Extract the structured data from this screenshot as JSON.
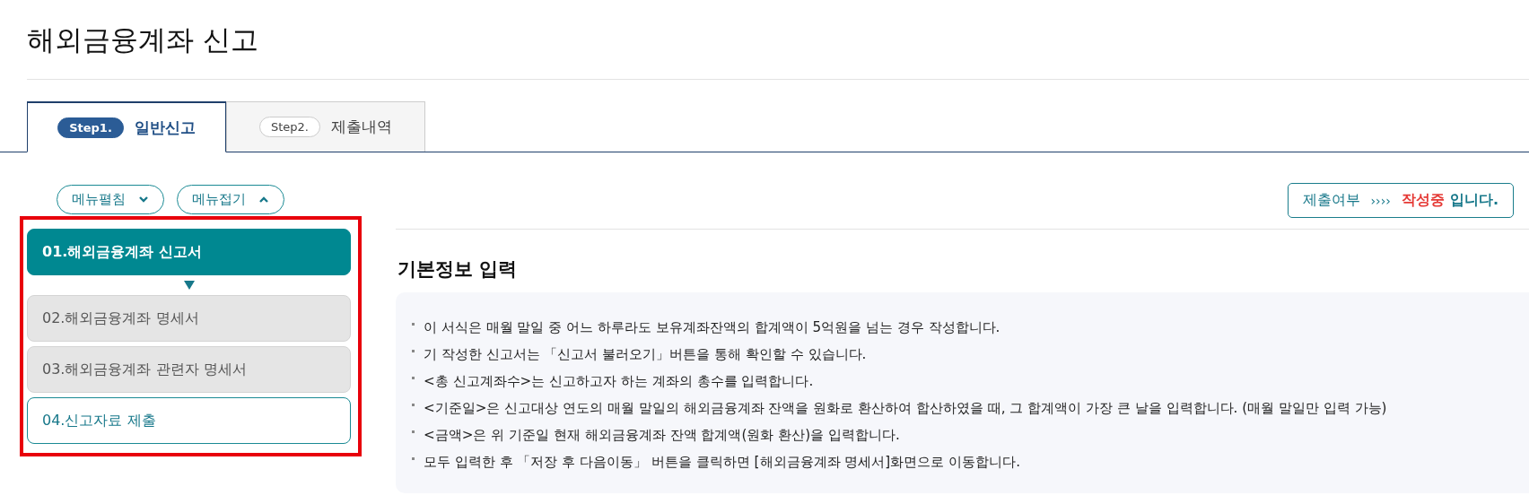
{
  "page_title": "해외금융계좌 신고",
  "tabs": [
    {
      "step": "Step1.",
      "label": "일반신고",
      "selected": true
    },
    {
      "step": "Step2.",
      "label": "제출내역",
      "selected": false
    }
  ],
  "menu_controls": [
    {
      "label": "메뉴펼침",
      "kind": "expand"
    },
    {
      "label": "메뉴접기",
      "kind": "collapse"
    }
  ],
  "menu_items": [
    {
      "label": "01.해외금융계좌 신고서",
      "selected": true,
      "disabled": false
    },
    {
      "label": "02.해외금융계좌 명세서",
      "selected": false,
      "disabled": true
    },
    {
      "label": "03.해외금융계좌 관련자 명세서",
      "selected": false,
      "disabled": true
    },
    {
      "label": "04.신고자료 제출",
      "selected": false,
      "disabled": false
    }
  ],
  "status": {
    "label": "제출여부",
    "arrows": "››››",
    "value": "작성중",
    "suffix": "입니다."
  },
  "section_title": "기본정보 입력",
  "notes": [
    "이 서식은 매월 말일 중 어느 하루라도 보유계좌잔액의 합계액이 5억원을 넘는 경우 작성합니다.",
    "기 작성한 신고서는 「신고서 불러오기」버튼을 통해 확인할 수 있습니다.",
    "<총 신고계좌수>는 신고하고자 하는 계좌의 총수를 입력합니다.",
    "<기준일>은 신고대상 연도의 매월 말일의 해외금융계좌 잔액을 원화로 환산하여 합산하였을 때, 그 합계액이 가장 큰 날을 입력합니다. (매월 말일만 입력 가능)",
    "<금액>은 위 기준일 현재 해외금융계좌 잔액 합계액(원화 환산)을 입력합니다.",
    "모두 입력한 후 「저장 후 다음이동」 버튼을 클릭하면 [해외금융계좌 명세서]화면으로 이동합니다."
  ]
}
